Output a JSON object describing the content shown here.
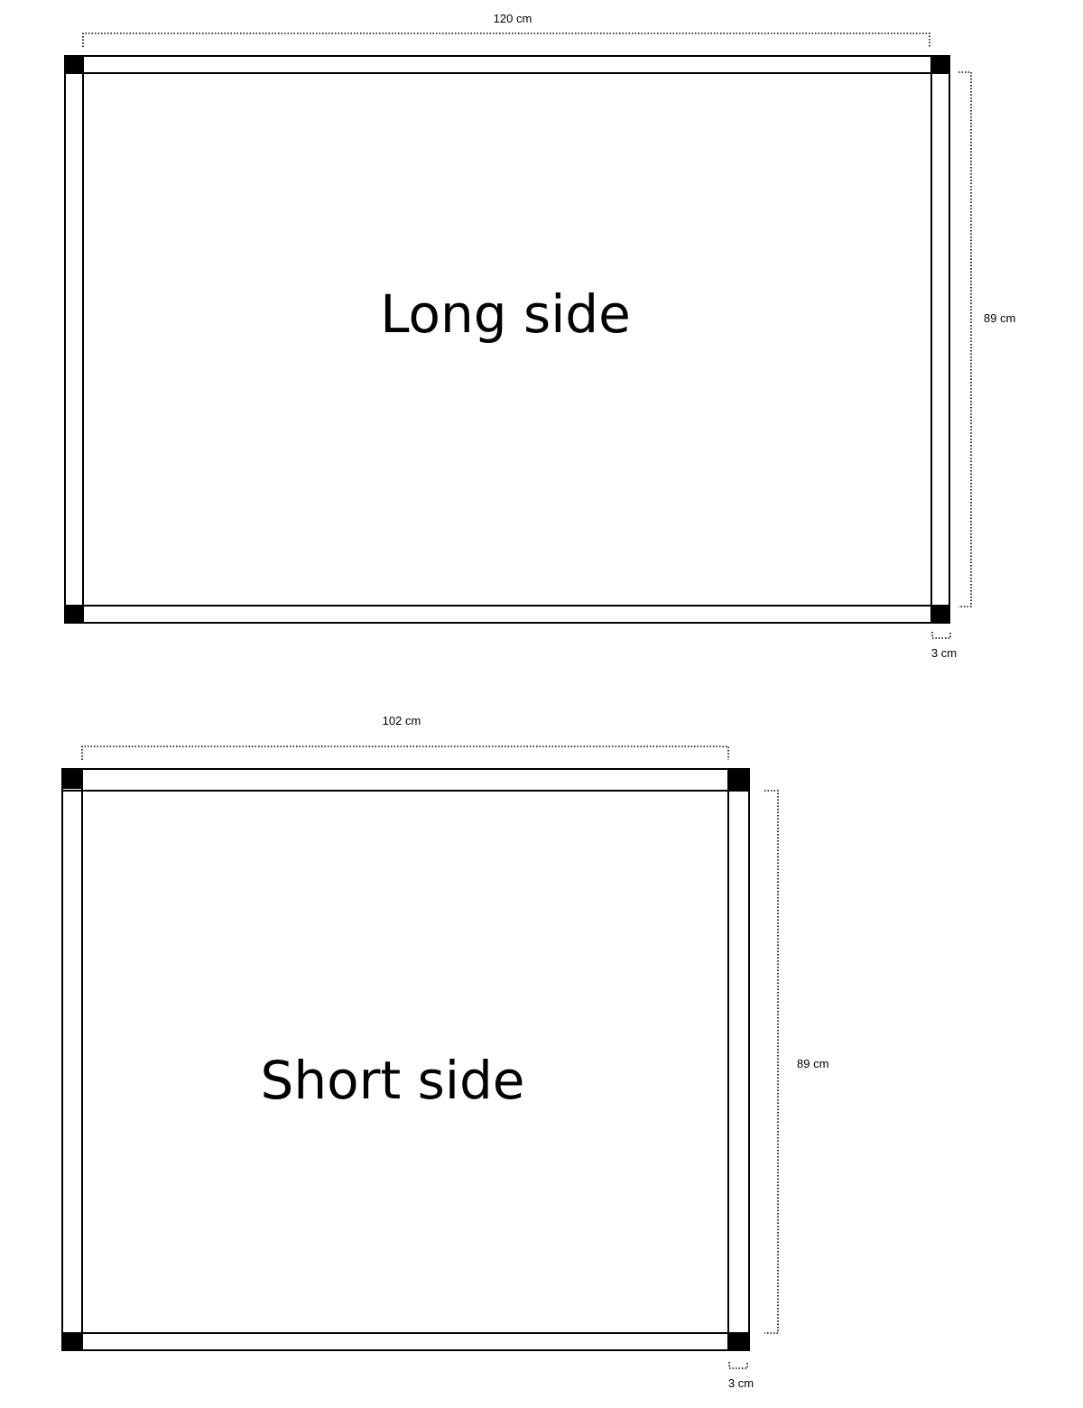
{
  "diagrams": {
    "long": {
      "title": "Long side",
      "width_label": "120 cm",
      "height_label": "89 cm",
      "post_label": "3 cm"
    },
    "short": {
      "title": "Short side",
      "width_label": "102 cm",
      "height_label": "89 cm",
      "post_label": "3 cm"
    }
  },
  "colors": {
    "line": "#000000",
    "background": "#ffffff"
  }
}
